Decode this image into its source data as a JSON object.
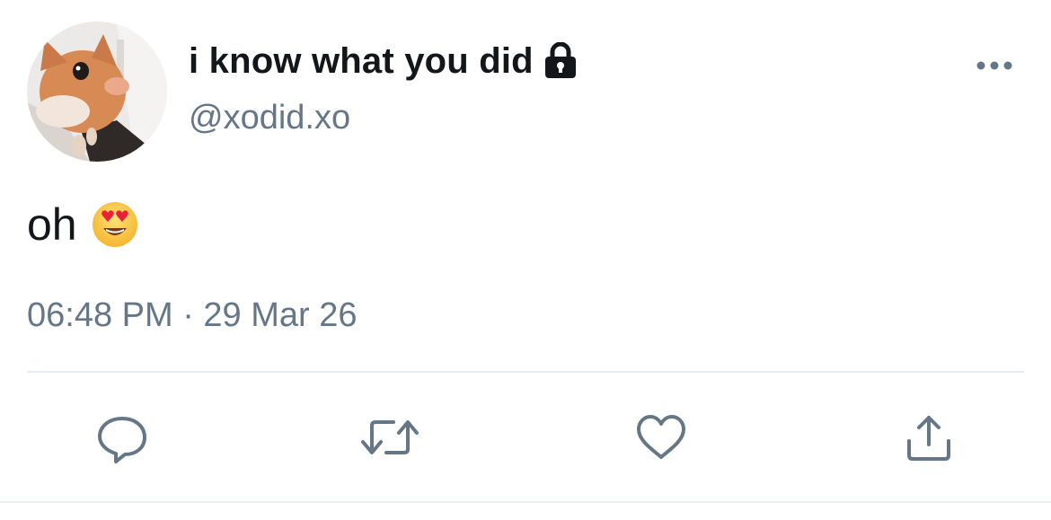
{
  "tweet": {
    "author": {
      "display_name": "i know what you did",
      "handle": "@xodid.xo",
      "avatar": "orange-cat-photo",
      "protected_icon": "lock-icon"
    },
    "text": "oh",
    "emoji": "smiling-face-with-heart-eyes-emoji",
    "timestamp": "06:48 PM · 29 Mar 26",
    "more_icon": "more-options-icon"
  },
  "actions": [
    {
      "name": "reply",
      "icon": "reply-icon"
    },
    {
      "name": "retweet",
      "icon": "retweet-icon"
    },
    {
      "name": "like",
      "icon": "heart-icon"
    },
    {
      "name": "share",
      "icon": "share-icon"
    }
  ],
  "colors": {
    "text_primary": "#14171a",
    "text_secondary": "#657786",
    "divider": "#e6ecf0",
    "icon": "#657786"
  }
}
